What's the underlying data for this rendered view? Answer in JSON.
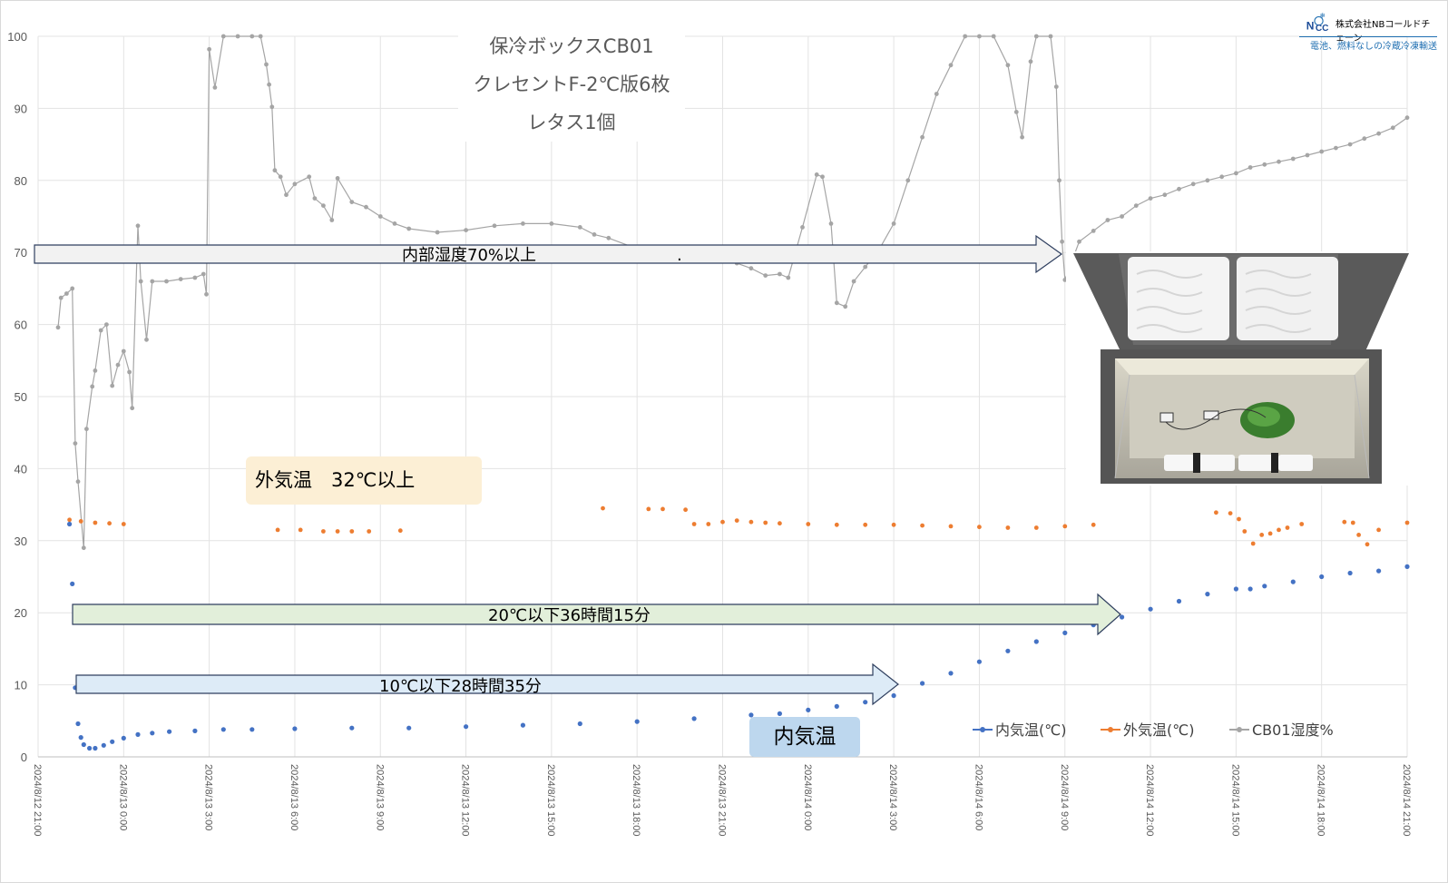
{
  "title_lines": [
    "保冷ボックスCB01",
    "クレセントF-2℃版6枚",
    "レタス1個"
  ],
  "logo": {
    "company": "株式会社NBコールドチェーン",
    "mark": "NBCC",
    "tagline": "電池、燃料なしの冷蔵冷凍輸送"
  },
  "annotations": {
    "humidity_arrow": "内部湿度70%以上",
    "outer_temp_box": "外気温　32℃以上",
    "below20_arrow": "20℃以下36時間15分",
    "below10_arrow": "10℃以下28時間35分",
    "inner_temp_box": "内気温",
    "stray_dot": "."
  },
  "colors": {
    "inner": "#4472c4",
    "outer": "#ed7d31",
    "humidity": "#a5a5a5",
    "grid": "#e3e3e3",
    "arrow_humidity_fill": "#f2f2f2",
    "arrow_humidity_stroke": "#2f3f5f",
    "arrow_20_fill": "#e2efda",
    "arrow_10_fill": "#ddebf7",
    "arrow_stroke": "#2f3f5f"
  },
  "chart_data": {
    "type": "scatter",
    "y_ticks": [
      "0",
      "10",
      "20",
      "30",
      "40",
      "50",
      "60",
      "70",
      "80",
      "90",
      "100"
    ],
    "ylim": [
      0,
      100
    ],
    "x_ticks": [
      "2024/8/12 21:00",
      "2024/8/13 0:00",
      "2024/8/13 3:00",
      "2024/8/13 6:00",
      "2024/8/13 9:00",
      "2024/8/13 12:00",
      "2024/8/13 15:00",
      "2024/8/13 18:00",
      "2024/8/13 21:00",
      "2024/8/14 0:00",
      "2024/8/14 3:00",
      "2024/8/14 6:00",
      "2024/8/14 9:00",
      "2024/8/14 12:00",
      "2024/8/14 15:00",
      "2024/8/14 18:00",
      "2024/8/14 21:00"
    ],
    "x_unit": "hours since 2024/8/12 21:00",
    "xlim": [
      0,
      48
    ],
    "legend_position": "bottom-right",
    "grid": "vertical and horizontal",
    "series": [
      {
        "name": "内気温(℃)",
        "key": "inner",
        "points": [
          [
            1.1,
            32.3
          ],
          [
            1.2,
            24.0
          ],
          [
            1.3,
            9.6
          ],
          [
            1.4,
            4.6
          ],
          [
            1.5,
            2.7
          ],
          [
            1.6,
            1.7
          ],
          [
            1.8,
            1.2
          ],
          [
            2.0,
            1.2
          ],
          [
            2.3,
            1.6
          ],
          [
            2.6,
            2.1
          ],
          [
            3.0,
            2.6
          ],
          [
            3.5,
            3.1
          ],
          [
            4.0,
            3.3
          ],
          [
            4.6,
            3.5
          ],
          [
            5.5,
            3.6
          ],
          [
            6.5,
            3.8
          ],
          [
            7.5,
            3.8
          ],
          [
            9,
            3.9
          ],
          [
            11,
            4.0
          ],
          [
            13,
            4.0
          ],
          [
            15,
            4.2
          ],
          [
            17,
            4.4
          ],
          [
            19,
            4.6
          ],
          [
            21,
            4.9
          ],
          [
            23,
            5.3
          ],
          [
            25,
            5.8
          ],
          [
            26,
            6.0
          ],
          [
            27,
            6.5
          ],
          [
            28,
            7.0
          ],
          [
            29,
            7.6
          ],
          [
            30,
            8.5
          ],
          [
            31,
            10.2
          ],
          [
            32,
            11.6
          ],
          [
            33,
            13.2
          ],
          [
            34,
            14.7
          ],
          [
            35,
            16.0
          ],
          [
            36,
            17.2
          ],
          [
            37,
            18.3
          ],
          [
            38,
            19.4
          ],
          [
            39,
            20.5
          ],
          [
            40,
            21.6
          ],
          [
            41,
            22.6
          ],
          [
            42,
            23.3
          ],
          [
            42.5,
            23.3
          ],
          [
            43,
            23.7
          ],
          [
            44,
            24.3
          ],
          [
            45,
            25.0
          ],
          [
            46,
            25.5
          ],
          [
            47,
            25.8
          ],
          [
            48,
            26.4
          ]
        ]
      },
      {
        "name": "外気温(℃)",
        "key": "outer",
        "points": [
          [
            1.1,
            32.9
          ],
          [
            1.5,
            32.7
          ],
          [
            2,
            32.5
          ],
          [
            2.5,
            32.4
          ],
          [
            3,
            32.3
          ],
          [
            8.4,
            31.5
          ],
          [
            9.2,
            31.5
          ],
          [
            10,
            31.3
          ],
          [
            10.5,
            31.3
          ],
          [
            11,
            31.3
          ],
          [
            11.6,
            31.3
          ],
          [
            12.7,
            31.4
          ],
          [
            19.8,
            34.5
          ],
          [
            21.4,
            34.4
          ],
          [
            21.9,
            34.4
          ],
          [
            22.7,
            34.3
          ],
          [
            23,
            32.3
          ],
          [
            23.5,
            32.3
          ],
          [
            24,
            32.6
          ],
          [
            24.5,
            32.8
          ],
          [
            25,
            32.6
          ],
          [
            25.5,
            32.5
          ],
          [
            26,
            32.4
          ],
          [
            27,
            32.3
          ],
          [
            28,
            32.2
          ],
          [
            29,
            32.2
          ],
          [
            30,
            32.2
          ],
          [
            31,
            32.1
          ],
          [
            32,
            32.0
          ],
          [
            33,
            31.9
          ],
          [
            34,
            31.8
          ],
          [
            35,
            31.8
          ],
          [
            36,
            32.0
          ],
          [
            37,
            32.2
          ],
          [
            41.3,
            33.9
          ],
          [
            41.8,
            33.8
          ],
          [
            42.1,
            33.0
          ],
          [
            42.3,
            31.3
          ],
          [
            42.6,
            29.6
          ],
          [
            42.9,
            30.8
          ],
          [
            43.2,
            31.0
          ],
          [
            43.5,
            31.5
          ],
          [
            43.8,
            31.8
          ],
          [
            44.3,
            32.3
          ],
          [
            45.8,
            32.6
          ],
          [
            46.1,
            32.5
          ],
          [
            46.3,
            30.8
          ],
          [
            46.6,
            29.5
          ],
          [
            47,
            31.5
          ],
          [
            48,
            32.5
          ]
        ]
      },
      {
        "name": "CB01湿度%",
        "key": "humidity",
        "points": [
          [
            0.7,
            59.6
          ],
          [
            0.8,
            63.7
          ],
          [
            1.0,
            64.3
          ],
          [
            1.2,
            65.0
          ],
          [
            1.3,
            43.5
          ],
          [
            1.4,
            38.2
          ],
          [
            1.6,
            29.0
          ],
          [
            1.7,
            45.5
          ],
          [
            1.9,
            51.4
          ],
          [
            2.0,
            53.6
          ],
          [
            2.2,
            59.2
          ],
          [
            2.4,
            60.0
          ],
          [
            2.6,
            51.5
          ],
          [
            2.8,
            54.4
          ],
          [
            3.0,
            56.3
          ],
          [
            3.2,
            53.4
          ],
          [
            3.3,
            48.4
          ],
          [
            3.5,
            73.7
          ],
          [
            3.6,
            66.0
          ],
          [
            3.8,
            57.9
          ],
          [
            4.0,
            66.0
          ],
          [
            4.5,
            66.0
          ],
          [
            5,
            66.3
          ],
          [
            5.5,
            66.5
          ],
          [
            5.8,
            67.0
          ],
          [
            5.9,
            64.2
          ],
          [
            6.0,
            98.2
          ],
          [
            6.2,
            92.9
          ],
          [
            6.5,
            100
          ],
          [
            7,
            100
          ],
          [
            7.5,
            100
          ],
          [
            7.8,
            100
          ],
          [
            8.0,
            96.1
          ],
          [
            8.1,
            93.3
          ],
          [
            8.2,
            90.2
          ],
          [
            8.3,
            81.4
          ],
          [
            8.5,
            80.5
          ],
          [
            8.7,
            78.0
          ],
          [
            9,
            79.5
          ],
          [
            9.5,
            80.5
          ],
          [
            9.7,
            77.5
          ],
          [
            10,
            76.5
          ],
          [
            10.3,
            74.5
          ],
          [
            10.5,
            80.3
          ],
          [
            11,
            77.0
          ],
          [
            11.5,
            76.3
          ],
          [
            12,
            75.0
          ],
          [
            12.5,
            74.0
          ],
          [
            13,
            73.3
          ],
          [
            14,
            72.8
          ],
          [
            15,
            73.1
          ],
          [
            16,
            73.7
          ],
          [
            17,
            74.0
          ],
          [
            18,
            74.0
          ],
          [
            19,
            73.5
          ],
          [
            19.5,
            72.5
          ],
          [
            20,
            72.0
          ],
          [
            21,
            70.5
          ],
          [
            22,
            70.2
          ],
          [
            23,
            69.8
          ],
          [
            24,
            69.2
          ],
          [
            24.5,
            68.5
          ],
          [
            25,
            67.8
          ],
          [
            25.5,
            66.8
          ],
          [
            26,
            67.0
          ],
          [
            26.3,
            66.5
          ],
          [
            26.8,
            73.5
          ],
          [
            27.3,
            80.8
          ],
          [
            27.5,
            80.5
          ],
          [
            27.8,
            74.0
          ],
          [
            28,
            63.0
          ],
          [
            28.3,
            62.5
          ],
          [
            28.6,
            66.0
          ],
          [
            29,
            68.0
          ],
          [
            29.5,
            70.5
          ],
          [
            30,
            74.0
          ],
          [
            30.5,
            80.0
          ],
          [
            31,
            86.0
          ],
          [
            31.5,
            92.0
          ],
          [
            32,
            96.0
          ],
          [
            32.5,
            100
          ],
          [
            33,
            100
          ],
          [
            33.5,
            100
          ],
          [
            34,
            96.0
          ],
          [
            34.3,
            89.5
          ],
          [
            34.5,
            86.0
          ],
          [
            34.8,
            96.5
          ],
          [
            35,
            100
          ],
          [
            35.5,
            100
          ],
          [
            35.7,
            93.0
          ],
          [
            35.8,
            80.0
          ],
          [
            35.9,
            71.5
          ],
          [
            36,
            66.2
          ],
          [
            36.5,
            71.5
          ],
          [
            37,
            73.0
          ],
          [
            37.5,
            74.5
          ],
          [
            38,
            75.0
          ],
          [
            38.5,
            76.5
          ],
          [
            39,
            77.5
          ],
          [
            39.5,
            78.0
          ],
          [
            40,
            78.8
          ],
          [
            40.5,
            79.5
          ],
          [
            41,
            80.0
          ],
          [
            41.5,
            80.5
          ],
          [
            42,
            81.0
          ],
          [
            42.5,
            81.8
          ],
          [
            43,
            82.2
          ],
          [
            43.5,
            82.6
          ],
          [
            44,
            83.0
          ],
          [
            44.5,
            83.5
          ],
          [
            45,
            84.0
          ],
          [
            45.5,
            84.5
          ],
          [
            46,
            85.0
          ],
          [
            46.5,
            85.8
          ],
          [
            47,
            86.5
          ],
          [
            47.5,
            87.3
          ],
          [
            48,
            88.7
          ]
        ]
      }
    ]
  }
}
